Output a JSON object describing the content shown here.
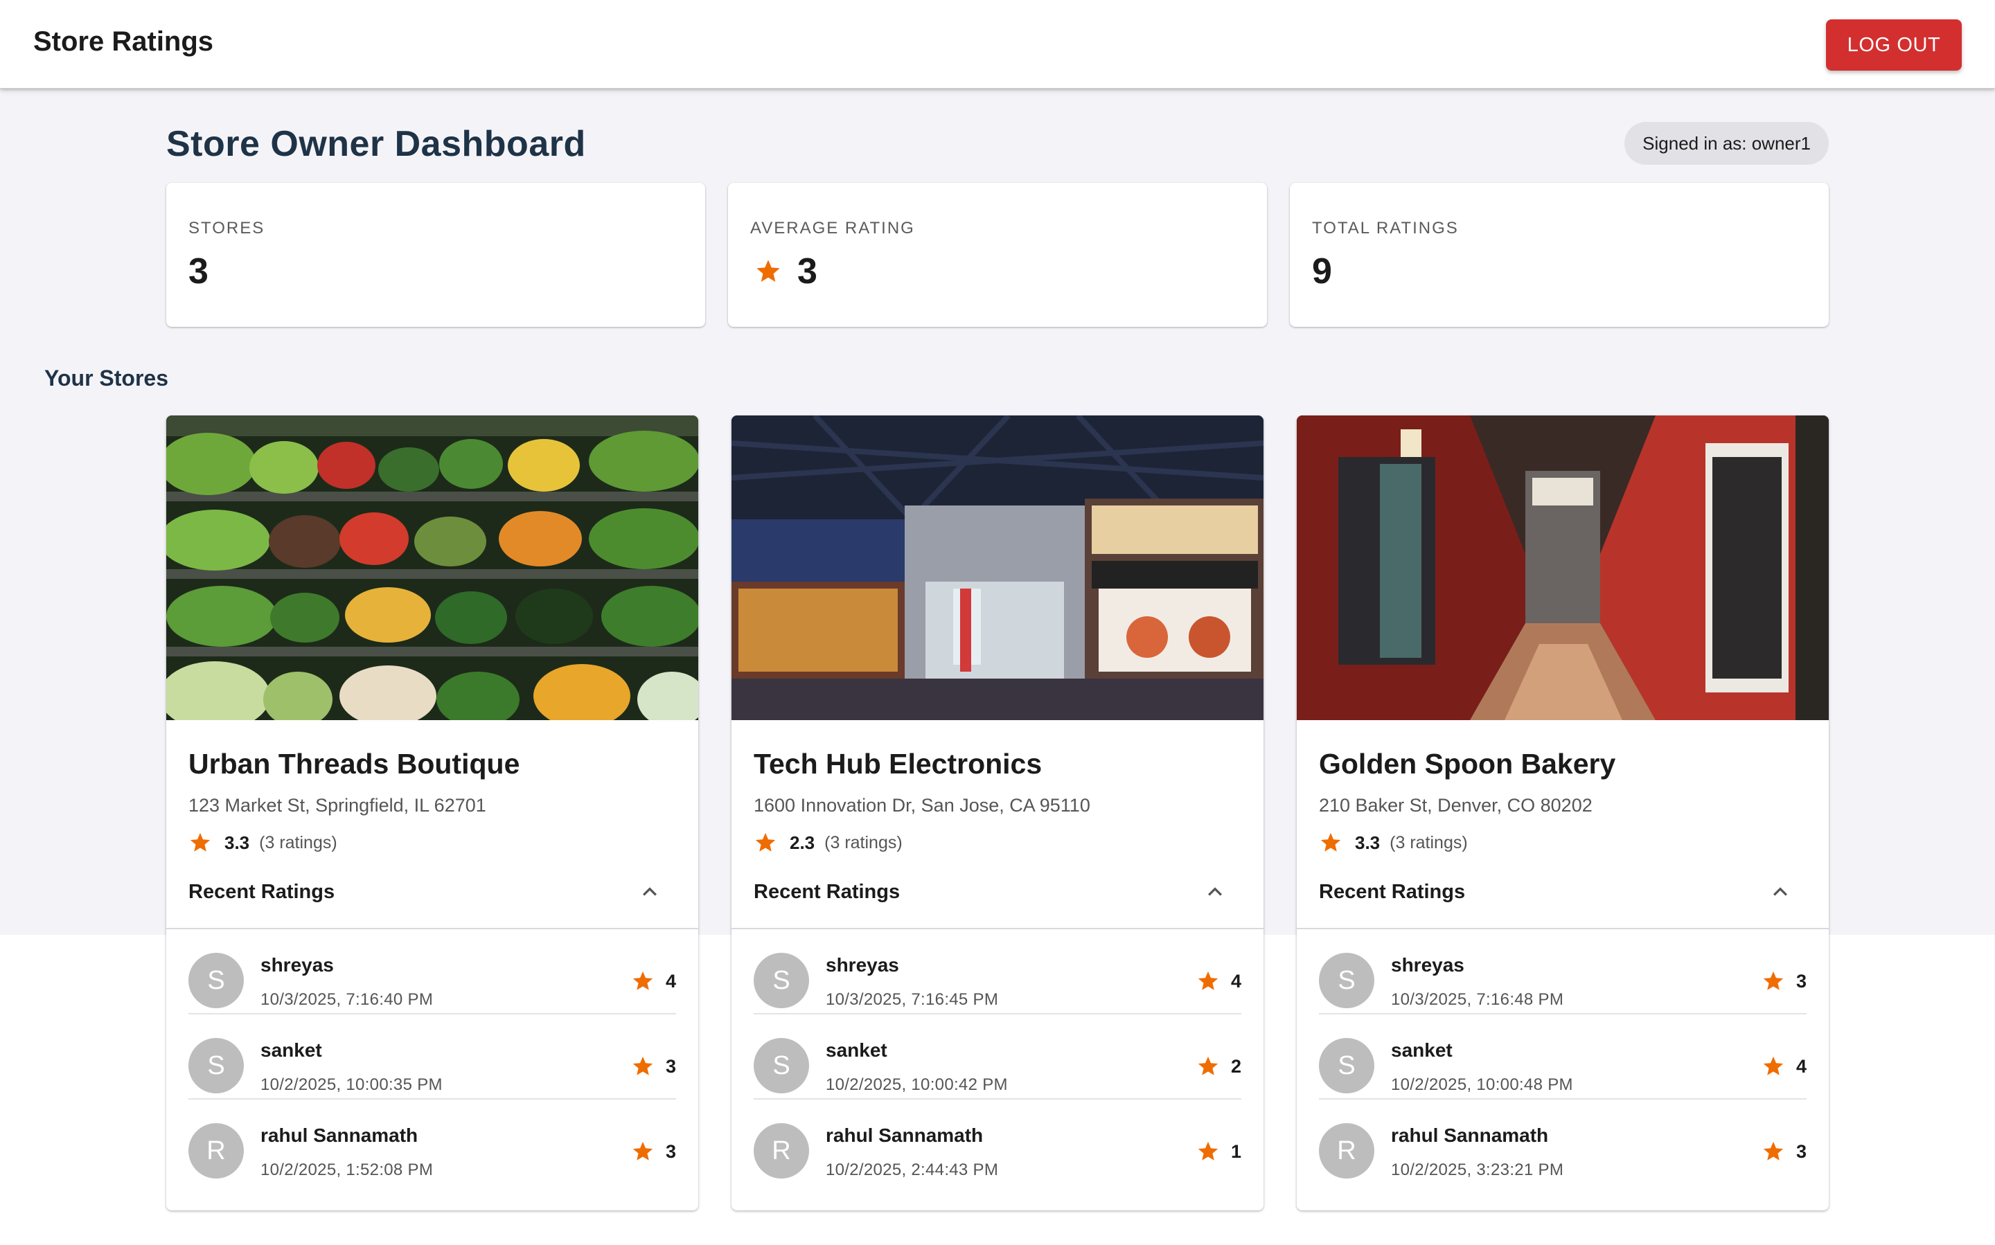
{
  "app": {
    "title": "Store Ratings",
    "logout_label": "LOG OUT"
  },
  "header": {
    "title": "Store Owner Dashboard",
    "signed_in": "Signed in as: owner1"
  },
  "stats": [
    {
      "label": "STORES",
      "value": "3"
    },
    {
      "label": "AVERAGE RATING",
      "value": "3",
      "icon": "star-icon"
    },
    {
      "label": "TOTAL RATINGS",
      "value": "9"
    }
  ],
  "section": {
    "title": "Your Stores"
  },
  "colors": {
    "accent_star": "#ef6c00",
    "logout": "#d32f2f",
    "avatar": "#bdbdbd",
    "heading": "#1f3347"
  },
  "stores": [
    {
      "name": "Urban Threads Boutique",
      "address": "123 Market St, Springfield, IL 62701",
      "avg": "3.3",
      "count": "(3 ratings)",
      "recent_title": "Recent Ratings",
      "ratings": [
        {
          "initial": "S",
          "name": "shreyas",
          "time": "10/3/2025, 7:16:40 PM",
          "score": "4"
        },
        {
          "initial": "S",
          "name": "sanket",
          "time": "10/2/2025, 10:00:35 PM",
          "score": "3"
        },
        {
          "initial": "R",
          "name": "rahul Sannamath",
          "time": "10/2/2025, 1:52:08 PM",
          "score": "3"
        }
      ]
    },
    {
      "name": "Tech Hub Electronics",
      "address": "1600 Innovation Dr, San Jose, CA 95110",
      "avg": "2.3",
      "count": "(3 ratings)",
      "recent_title": "Recent Ratings",
      "ratings": [
        {
          "initial": "S",
          "name": "shreyas",
          "time": "10/3/2025, 7:16:45 PM",
          "score": "4"
        },
        {
          "initial": "S",
          "name": "sanket",
          "time": "10/2/2025, 10:00:42 PM",
          "score": "2"
        },
        {
          "initial": "R",
          "name": "rahul Sannamath",
          "time": "10/2/2025, 2:44:43 PM",
          "score": "1"
        }
      ]
    },
    {
      "name": "Golden Spoon Bakery",
      "address": "210 Baker St, Denver, CO 80202",
      "avg": "3.3",
      "count": "(3 ratings)",
      "recent_title": "Recent Ratings",
      "ratings": [
        {
          "initial": "S",
          "name": "shreyas",
          "time": "10/3/2025, 7:16:48 PM",
          "score": "3"
        },
        {
          "initial": "S",
          "name": "sanket",
          "time": "10/2/2025, 10:00:48 PM",
          "score": "4"
        },
        {
          "initial": "R",
          "name": "rahul Sannamath",
          "time": "10/2/2025, 3:23:21 PM",
          "score": "3"
        }
      ]
    }
  ]
}
